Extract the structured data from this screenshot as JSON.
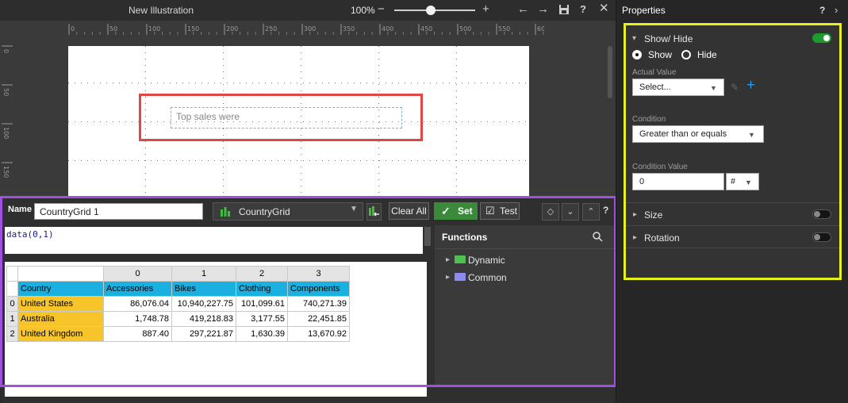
{
  "topbar": {
    "title": "New Illustration",
    "zoom": "100%"
  },
  "rulers": {
    "top": [
      "0",
      "50",
      "100",
      "150",
      "200",
      "250",
      "300",
      "350",
      "400",
      "450",
      "500",
      "550",
      "600"
    ],
    "left": [
      "0",
      "50",
      "100",
      "150"
    ]
  },
  "canvas": {
    "textbox": "Top sales were"
  },
  "editor": {
    "name_label": "Name",
    "name_value": "CountryGrid 1",
    "grid_select": "CountryGrid",
    "clear_label": "Clear All",
    "set_label": "Set",
    "test_label": "Test",
    "help": "?",
    "formula": "data(0,1)"
  },
  "functions": {
    "title": "Functions",
    "items": [
      "Dynamic",
      "Common"
    ]
  },
  "grid": {
    "col_indices": [
      "0",
      "1",
      "2",
      "3"
    ],
    "headers": [
      "Country",
      "Accessories",
      "Bikes",
      "Clothing",
      "Components"
    ],
    "rows": [
      {
        "idx": "0",
        "country": "United States",
        "values": [
          "86,076.04",
          "10,940,227.75",
          "101,099.61",
          "740,271.39"
        ]
      },
      {
        "idx": "1",
        "country": "Australia",
        "values": [
          "1,748.78",
          "419,218.83",
          "3,177.55",
          "22,451.85"
        ]
      },
      {
        "idx": "2",
        "country": "United Kingdom",
        "values": [
          "887.40",
          "297,221.87",
          "1,630.39",
          "13,670.92"
        ]
      }
    ]
  },
  "properties": {
    "title": "Properties",
    "help": "?",
    "show_hide": {
      "label": "Show/ Hide",
      "enabled": true,
      "radio_show": "Show",
      "radio_hide": "Hide",
      "actual_value_label": "Actual Value",
      "actual_value": "Select...",
      "condition_label": "Condition",
      "condition": "Greater than or equals",
      "condition_value_label": "Condition Value",
      "condition_value": "0",
      "type_symbol": "#"
    },
    "size": {
      "label": "Size",
      "enabled": false
    },
    "rotation": {
      "label": "Rotation",
      "enabled": false
    }
  },
  "colors": {
    "accent_green": "#1f9a2f",
    "header_blue": "#1ab0e0",
    "row_yellow": "#f7c52a",
    "highlight_red": "#e04848",
    "highlight_purple": "#a050e0",
    "highlight_yellow": "#e6f01e"
  }
}
